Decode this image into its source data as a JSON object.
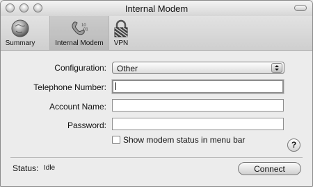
{
  "window": {
    "title": "Internal Modem"
  },
  "toolbar": {
    "items": [
      {
        "label": "Summary",
        "icon": "globe-icon",
        "selected": false
      },
      {
        "label": "Internal Modem",
        "icon": "phone-modem-icon",
        "selected": true
      },
      {
        "label": "VPN",
        "icon": "lock-icon",
        "selected": false
      }
    ]
  },
  "form": {
    "configuration_label": "Configuration:",
    "configuration_value": "Other",
    "telephone_label": "Telephone Number:",
    "telephone_value": "",
    "account_label": "Account Name:",
    "account_value": "",
    "password_label": "Password:",
    "password_value": "",
    "show_status_label": "Show modem status in menu bar",
    "show_status_checked": false
  },
  "help": {
    "label": "?"
  },
  "status": {
    "label": "Status:",
    "value": "Idle"
  },
  "connect_button": {
    "label": "Connect"
  }
}
